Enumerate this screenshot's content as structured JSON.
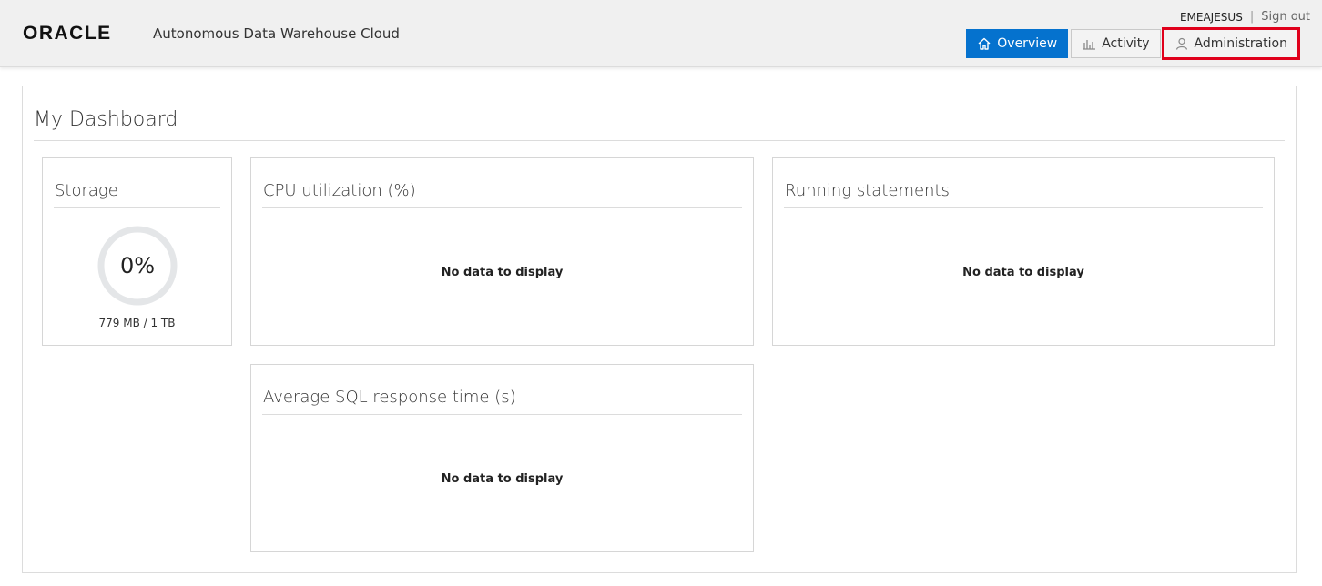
{
  "header": {
    "brand": "ORACLE",
    "app_title": "Autonomous Data Warehouse Cloud",
    "username": "EMEAJESUS",
    "separator": "|",
    "signout_label": "Sign out"
  },
  "nav": {
    "overview_label": "Overview",
    "activity_label": "Activity",
    "administration_label": "Administration",
    "active": "Overview",
    "accent_color": "#0572ce",
    "highlight_color": "#e0001b"
  },
  "dashboard": {
    "title": "My Dashboard",
    "storage": {
      "title": "Storage",
      "percent_label": "0%",
      "percent_value": 0,
      "usage_label": "779 MB / 1 TB"
    },
    "cpu": {
      "title": "CPU utilization (%)",
      "empty_message": "No data to display"
    },
    "running": {
      "title": "Running statements",
      "empty_message": "No data to display"
    },
    "sql_response": {
      "title": "Average SQL response time (s)",
      "empty_message": "No data to display"
    }
  }
}
